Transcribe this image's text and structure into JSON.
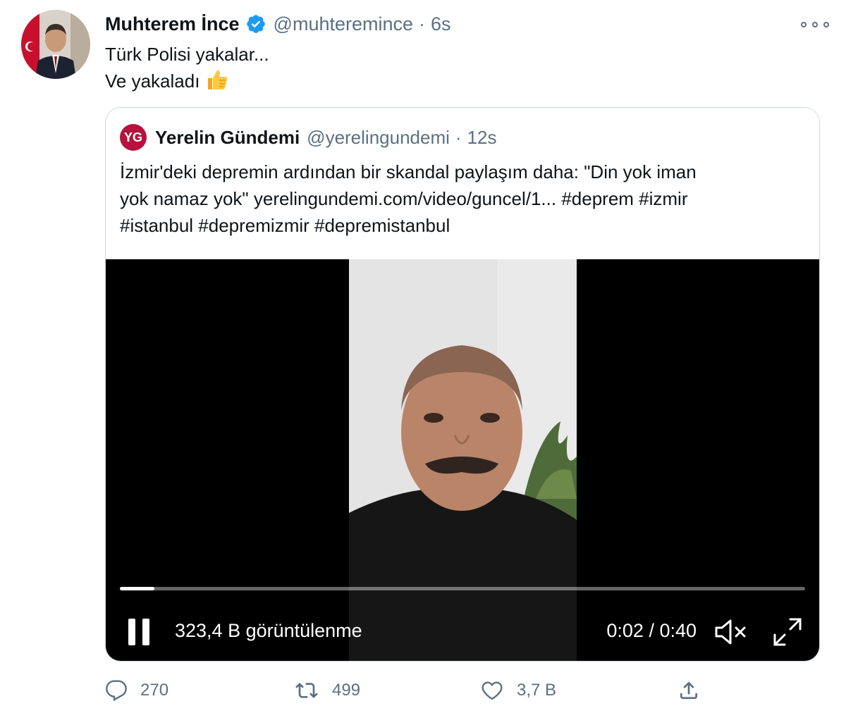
{
  "tweet": {
    "author_name": "Muhterem İnce",
    "author_handle": "@muhteremince",
    "separator": "·",
    "time": "6s",
    "text_line1": "Türk Polisi yakalar...",
    "text_line2": "Ve yakaladı",
    "emoji": "thumbs-up-icon"
  },
  "quoted": {
    "logo_letters": "YG",
    "author_name": "Yerelin Gündemi",
    "author_handle": "@yerelingundemi",
    "separator": "·",
    "time": "12s",
    "text_line1": "İzmir'deki depremin ardından bir skandal paylaşım daha: \"Din yok iman",
    "text_line2": "yok namaz yok\" yerelingundemi.com/video/guncel/1... #deprem #izmir",
    "text_line3": "#istanbul #depremizmir #depremistanbul"
  },
  "video": {
    "views": "323,4 B görüntülenme",
    "timecode": "0:02 / 0:40",
    "progress": 0.05
  },
  "actions": {
    "reply_count": "270",
    "retweet_count": "499",
    "like_count": "3,7 B"
  },
  "colors": {
    "text_primary": "#0f1419",
    "text_secondary": "#5b7083",
    "verified": "#1d9bf0",
    "brand_logo": "#b5123d",
    "border": "#cfd9de"
  }
}
